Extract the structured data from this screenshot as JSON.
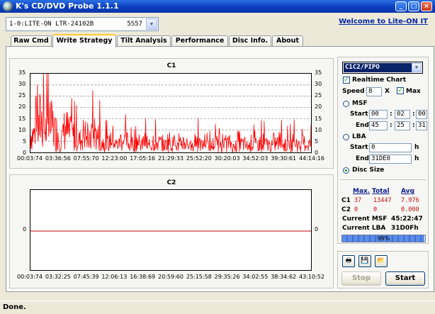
{
  "window": {
    "title": "K's CD/DVD Probe 1.1.1",
    "min": "_",
    "max": "□",
    "close": "×"
  },
  "drive": {
    "name": "1-0:LITE-ON LTR-24102B",
    "version": "5S57"
  },
  "welcome_link": "Welcome to Lite-ON IT",
  "tabs": [
    "Raw Cmd",
    "Write Strategy",
    "Tilt Analysis",
    "Performance",
    "Disc Info.",
    "About"
  ],
  "active_tab": "Write Strategy",
  "c1_graph": {
    "title": "C1",
    "y_ticks": [
      "35",
      "30",
      "25",
      "20",
      "15",
      "10",
      "5",
      "0"
    ],
    "x_ticks": [
      "00:03:74",
      "03:36:56",
      "07:55:70",
      "12:23:00",
      "17:05:16",
      "21:29:33",
      "25:52:20",
      "30:20:03",
      "34:52:03",
      "39:30:61",
      "44:14:16"
    ]
  },
  "c2_graph": {
    "title": "C2",
    "y_ticks": [
      "0"
    ],
    "x_ticks": [
      "00:03:74",
      "03:32:25",
      "07:45:39",
      "12:06:13",
      "16:38:69",
      "20:59:60",
      "25:15:58",
      "29:35:26",
      "34:02:55",
      "38:34:62",
      "43:10:52"
    ]
  },
  "chart_data": [
    {
      "type": "line",
      "title": "C1",
      "xlabel": "",
      "ylabel": "",
      "ylim": [
        0,
        35
      ],
      "x_range": [
        "00:03:74",
        "45:22:47"
      ],
      "series": [
        {
          "values": [
            18,
            24,
            31,
            22,
            26,
            20,
            14,
            22,
            18,
            16,
            12,
            18,
            11,
            20,
            15,
            10,
            9,
            14,
            8,
            12,
            11,
            8,
            13,
            7,
            10,
            6,
            12,
            9,
            7,
            11,
            8,
            6,
            10,
            9,
            5,
            12,
            7,
            9,
            6,
            8,
            10,
            7,
            9,
            5,
            11,
            8,
            6,
            9,
            7,
            10,
            8,
            6,
            9,
            11,
            7,
            8,
            10,
            6,
            9,
            8
          ]
        }
      ],
      "peak_max": 37,
      "color": "#ff0000",
      "grid": true
    },
    {
      "type": "line",
      "title": "C2",
      "xlabel": "",
      "ylabel": "",
      "x_range": [
        "00:03:74",
        "45:22:47"
      ],
      "series": [
        {
          "values": [
            0,
            0
          ]
        }
      ],
      "color": "#c00000",
      "grid": false
    }
  ],
  "controls": {
    "scan_type": "C1C2/PIPO",
    "realtime_chart_label": "Realtime Chart",
    "speed_label": "Speed",
    "speed_value": "8",
    "speed_unit": "X",
    "max_label": "Max",
    "msf_label": "MSF",
    "start_label": "Start",
    "end_label": "End",
    "msf_start": [
      "00",
      "02",
      "00"
    ],
    "msf_end": [
      "45",
      "25",
      "31"
    ],
    "lba_label": "LBA",
    "lba_start": "0",
    "lba_end": "31DE0",
    "lba_unit": "h",
    "disc_size_label": "Disc Size",
    "colon": ":"
  },
  "stats": {
    "headers": [
      "Max.",
      "Total",
      "Avg"
    ],
    "rows": [
      {
        "name": "C1",
        "max": "37",
        "total": "13447",
        "avg": "7.976"
      },
      {
        "name": "C2",
        "max": "0",
        "total": "0",
        "avg": "0.000"
      }
    ],
    "current_msf_label": "Current MSF",
    "current_msf": "45:22:47",
    "current_lba_label": "Current LBA",
    "current_lba": "31D0Fh",
    "progress_percent": 99,
    "progress_text": "99%"
  },
  "buttons": {
    "stop": "Stop",
    "start": "Start"
  },
  "status": "Done."
}
